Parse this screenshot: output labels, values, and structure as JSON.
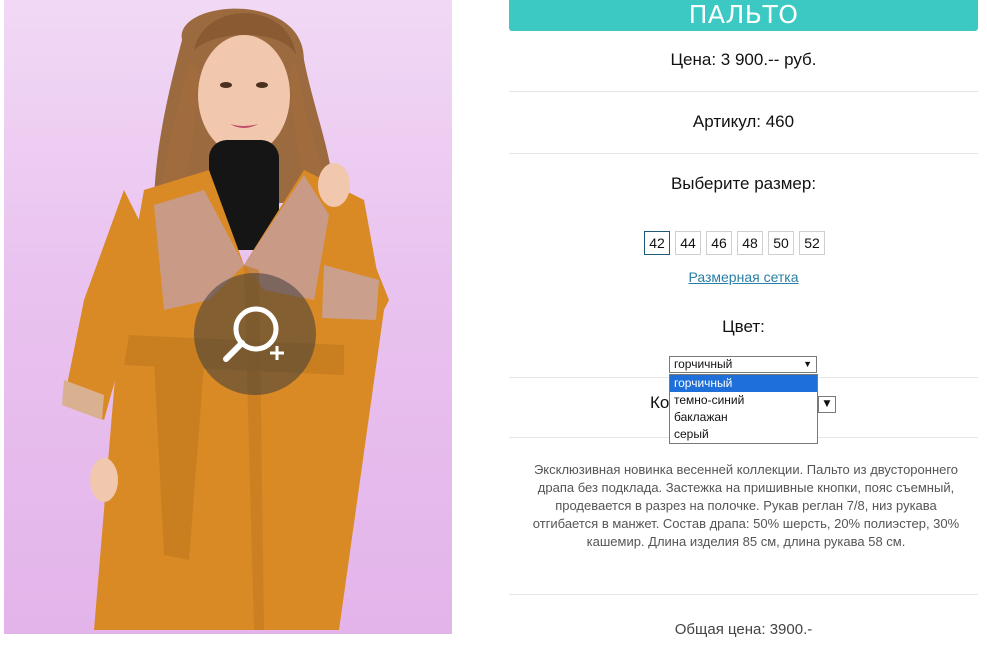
{
  "product": {
    "title": "ПАЛЬТО",
    "price_text": "Цена: 3 900.-- руб.",
    "article_text": "Артикул: 460",
    "choose_size_label": "Выберите размер:",
    "sizes": [
      "42",
      "44",
      "46",
      "48",
      "50",
      "52"
    ],
    "selected_size": "42",
    "size_chart_link": "Размерная сетка",
    "color_label": "Цвет:",
    "color_select": {
      "value": "горчичный",
      "options": [
        "горчичный",
        "темно-синий",
        "баклажан",
        "серый"
      ],
      "highlighted": "горчичный"
    },
    "quantity_label_visible": "Ко",
    "description": "Эксклюзивная новинка весенней коллекции. Пальто из двустороннего драпа без подклада. Застежка на пришивные кнопки, пояс съемный, продевается в разрез на полочке. Рукав реглан 7/8, низ рукава отгибается в манжет. Состав драпа: 50% шерсть, 20% полиэстер, 30% кашемир. Длина изделия 85 см, длина рукава 58 см.",
    "total_text": "Общая цена: 3900.-"
  },
  "icons": {
    "zoom": "zoom-in-icon",
    "dropdown_arrow": "triangle-down-icon"
  },
  "colors": {
    "accent": "#3cc9c3",
    "link": "#2a7fa6",
    "selected_option": "#1e6fd9",
    "coat": "#d98a25"
  }
}
